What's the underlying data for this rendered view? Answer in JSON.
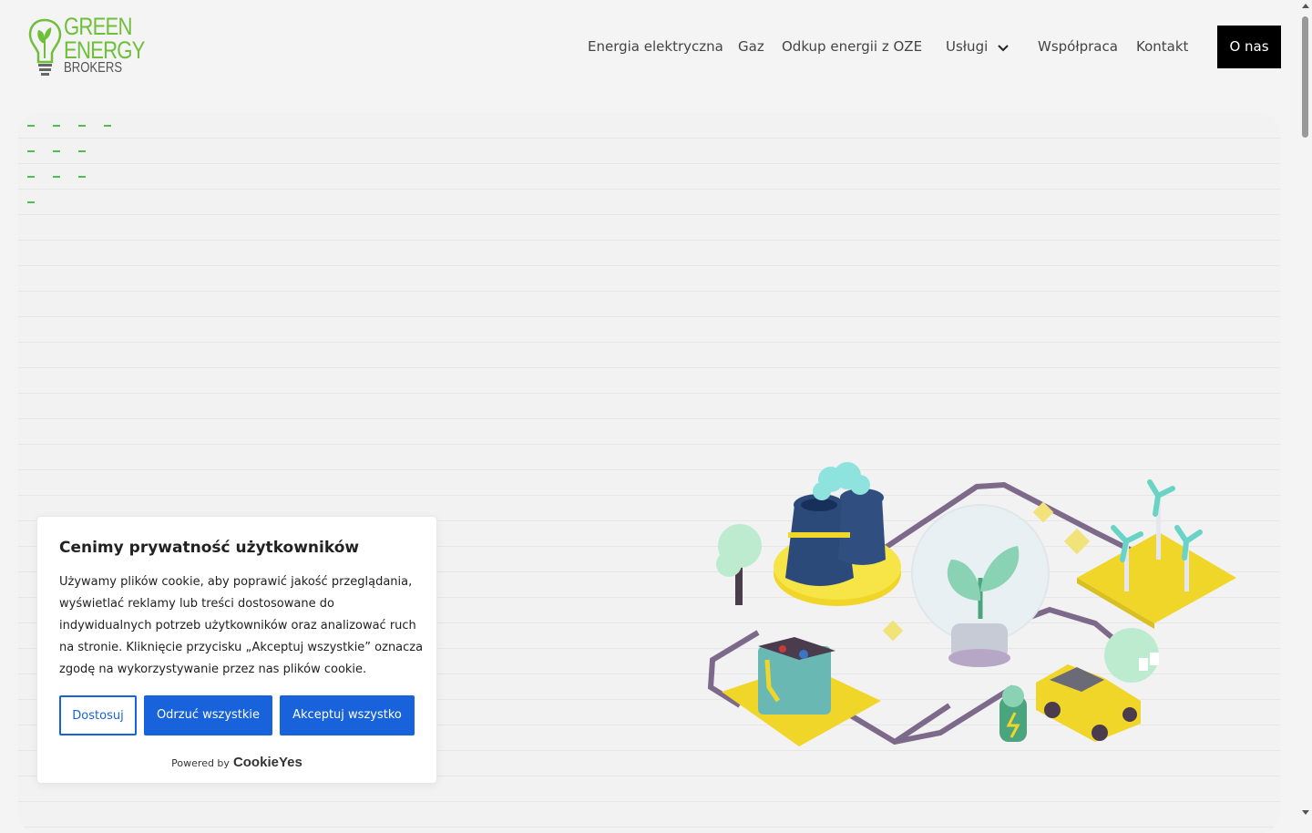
{
  "header": {
    "logo": {
      "line1": "GREEN",
      "line2": "ENERGY",
      "line3": "BROKERS"
    },
    "nav": [
      {
        "label": "Energia elektryczna"
      },
      {
        "label": "Gaz"
      },
      {
        "label": "Odkup energii z OZE"
      },
      {
        "label": "Usługi"
      },
      {
        "label": "Współpraca"
      },
      {
        "label": "Kontakt"
      }
    ],
    "cta_label": "O nas"
  },
  "cookie_banner": {
    "title": "Cenimy prywatność użytkowników",
    "text": "Używamy plików cookie, aby poprawić jakość przeglądania, wyświetlać reklamy lub treści dostosowane do indywidualnych potrzeb użytkowników oraz analizować ruch na stronie. Kliknięcie przycisku „Akceptuj wszystkie” oznacza zgodę na wykorzystywanie przez nas plików cookie.",
    "customize_label": "Dostosuj",
    "reject_label": "Odrzuć wszystkie",
    "accept_label": "Akceptuj wszystko",
    "powered_by": "Powered by",
    "powered_brand": "CookieYes"
  },
  "colors": {
    "brand_green": "#6fbf3a",
    "button_blue": "#1863dc",
    "cta_black": "#000000"
  }
}
